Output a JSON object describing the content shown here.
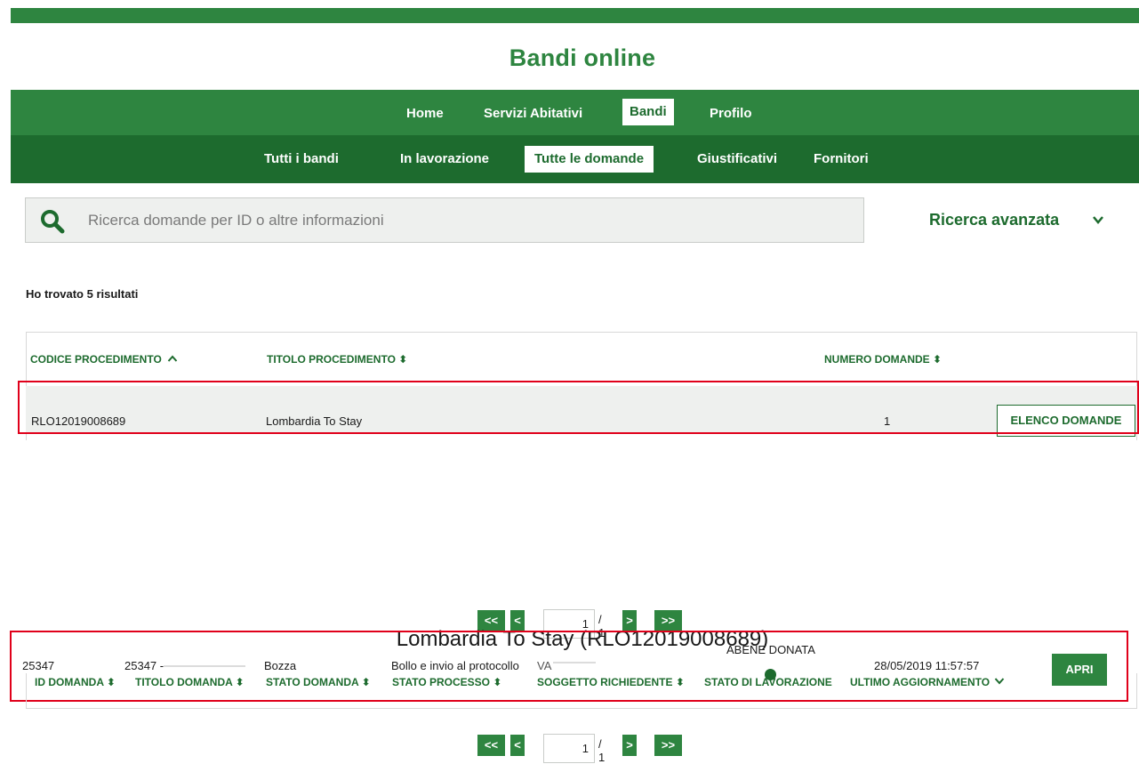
{
  "header": {
    "title": "Bandi online"
  },
  "nav_main": [
    {
      "label": "Home"
    },
    {
      "label": "Servizi Abitativi"
    },
    {
      "label": "Bandi"
    },
    {
      "label": "Profilo"
    }
  ],
  "nav_sub": [
    {
      "label": "Tutti i bandi"
    },
    {
      "label": "In lavorazione"
    },
    {
      "label": "Tutte le domande"
    },
    {
      "label": "Giustificativi"
    },
    {
      "label": "Fornitori"
    }
  ],
  "search": {
    "placeholder": "Ricerca domande per ID o altre informazioni",
    "advanced_label": "Ricerca avanzata"
  },
  "results_text": "Ho trovato 5 risultati",
  "procedures_table": {
    "headers": [
      "CODICE PROCEDIMENTO",
      "TITOLO PROCEDIMENTO",
      "NUMERO DOMANDE"
    ],
    "header_icons": [
      "^",
      "⬍",
      "⬍"
    ],
    "rows": [
      {
        "codice": "RLO12019008689",
        "titolo": "Lombardia To Stay",
        "numero": "1",
        "action": "ELENCO DOMANDE"
      }
    ]
  },
  "pager1": {
    "first": "<<",
    "prev": "<",
    "current": "1",
    "total": "/ 1",
    "next": ">",
    "last": ">>"
  },
  "detail": {
    "title": "Lombardia To Stay (RLO12019008689)",
    "headers": [
      "ID DOMANDA",
      "TITOLO DOMANDA",
      "STATO DOMANDA",
      "STATO PROCESSO",
      "SOGGETTO RICHIEDENTE",
      "STATO DI LAVORAZIONE",
      "ULTIMO AGGIORNAMENTO"
    ],
    "sort_icon": "⬍",
    "row": {
      "id": "25347",
      "titolo": "25347 -",
      "stato_domanda": "Bozza",
      "stato_processo": "Bollo e invio al protocollo",
      "soggetto": "VA",
      "stato_lavorazione": "ABENE DONATA",
      "ultimo_aggiornamento": "28/05/2019 11:57:57",
      "action": "APRI"
    }
  },
  "pager2": {
    "first": "<<",
    "prev": "<",
    "current": "1",
    "total": "/ 1",
    "next": ">",
    "last": ">>"
  },
  "colors": {
    "primary": "#2e8540",
    "primary_dark": "#1d6b2e",
    "highlight": "#e0001a"
  }
}
